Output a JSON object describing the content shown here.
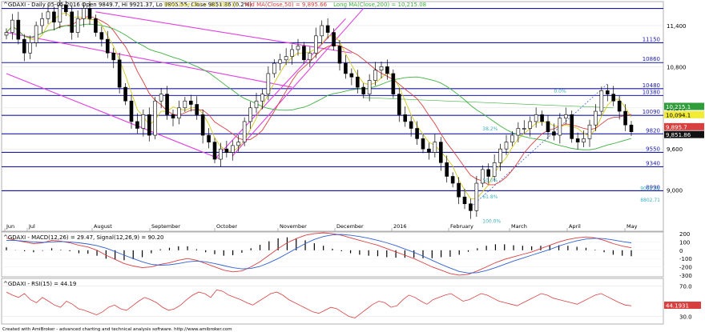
{
  "chart_data": [
    {
      "type": "candlestick",
      "title": "^GDAXI - Daily 05-05-2016 Open 9849.7, Hi 9921.37, Lo 9805.55, Close 9851.86 (0.2%)",
      "legend": [
        {
          "text": "MA(Close,20) = 10,094.12",
          "color": "#d4c81c"
        },
        {
          "text": "Mid MA(Close,50) = 9,895.66",
          "color": "#d84040"
        },
        {
          "text": "Long MA(Close,200) = 10,215.08",
          "color": "#40b040"
        }
      ],
      "y_ticks": [
        "11,400",
        "10,800",
        "10,200",
        "9,600",
        "9,000"
      ],
      "x_labels": [
        "Jun",
        "Jul",
        "August",
        "September",
        "October",
        "November",
        "December",
        "2016",
        "February",
        "March",
        "April",
        "May"
      ],
      "horizontal_levels": [
        {
          "value": 11650
        },
        {
          "value": 11150,
          "label": "11150"
        },
        {
          "value": 10860,
          "label": "10860"
        },
        {
          "value": 10480,
          "label": "10480"
        },
        {
          "value": 10380,
          "label": "10380"
        },
        {
          "value": 10090,
          "label": "10090"
        },
        {
          "value": 9820,
          "label": "9820"
        },
        {
          "value": 9550,
          "label": "9550"
        },
        {
          "value": 9340,
          "label": "9340"
        },
        {
          "value": 8990,
          "label": "8990"
        }
      ],
      "fib_labels": [
        "0.0%",
        "38.2%",
        "50.0%",
        "61.8%",
        "100.0%"
      ],
      "fib_price_labels": [
        "9000.55",
        "8802.71"
      ],
      "price_tags": [
        {
          "text": "10,215.1",
          "bg": "#2f9e3a",
          "fg": "#ffffff"
        },
        {
          "text": "10,094.1",
          "bg": "#f2ec36",
          "fg": "#000000"
        },
        {
          "text": "9,895.7",
          "bg": "#d84040",
          "fg": "#ffffff"
        },
        {
          "text": "9,851.86",
          "bg": "#111111",
          "fg": "#ffffff"
        }
      ],
      "ylim": [
        8400,
        11750
      ],
      "approx_closes": [
        11300,
        11480,
        11200,
        11000,
        11150,
        11400,
        11500,
        11600,
        11450,
        11700,
        11600,
        11300,
        11500,
        11650,
        11500,
        11300,
        11200,
        11000,
        10900,
        10500,
        10300,
        10000,
        9900,
        10100,
        9800,
        10300,
        10400,
        10100,
        10050,
        10200,
        10300,
        10250,
        10100,
        9800,
        9700,
        9450,
        9600,
        9550,
        9650,
        9700,
        10000,
        10200,
        10300,
        10400,
        10700,
        10850,
        10900,
        10950,
        11050,
        11100,
        10900,
        11000,
        11250,
        11400,
        11300,
        11100,
        10850,
        10700,
        10650,
        10500,
        10400,
        10600,
        10750,
        10800,
        10700,
        10400,
        10100,
        10000,
        9900,
        9750,
        9600,
        9550,
        9700,
        9400,
        9200,
        9100,
        8900,
        8800,
        8700,
        9100,
        9300,
        9200,
        9400,
        9600,
        9700,
        9800,
        9900,
        9900,
        10000,
        10100,
        10000,
        9850,
        9800,
        10050,
        10100,
        9750,
        9700,
        9750,
        9950,
        10150,
        10450,
        10400,
        10300,
        10150,
        9950,
        9851
      ]
    },
    {
      "type": "line",
      "title": "^GDAXI - MACD(12,26) = 29.47, Signal(12,26,9) = 90.20",
      "series": [
        {
          "name": "MACD(12,26)",
          "color": "#d84040"
        },
        {
          "name": "Signal(12,26,9)",
          "color": "#3060d0"
        }
      ],
      "y_ticks": [
        "200",
        "100",
        "0",
        "-100",
        "-200",
        "-300"
      ],
      "approx_macd": [
        150,
        120,
        100,
        80,
        90,
        120,
        110,
        90,
        60,
        40,
        0,
        -60,
        -110,
        -160,
        -190,
        -210,
        -200,
        -170,
        -150,
        -120,
        -100,
        -120,
        -160,
        -200,
        -240,
        -260,
        -250,
        -200,
        -140,
        -60,
        20,
        90,
        140,
        180,
        200,
        210,
        200,
        180,
        150,
        120,
        90,
        60,
        20,
        -20,
        -60,
        -100,
        -150,
        -200,
        -240,
        -280,
        -300,
        -290,
        -250,
        -200,
        -150,
        -110,
        -80,
        -50,
        -20,
        20,
        60,
        100,
        130,
        150,
        160,
        150,
        120,
        80,
        50,
        30
      ],
      "approx_signal": [
        120,
        118,
        110,
        100,
        95,
        100,
        105,
        100,
        90,
        75,
        55,
        25,
        -15,
        -60,
        -100,
        -140,
        -170,
        -180,
        -175,
        -160,
        -140,
        -130,
        -140,
        -160,
        -185,
        -210,
        -225,
        -220,
        -195,
        -150,
        -100,
        -40,
        20,
        80,
        130,
        165,
        185,
        190,
        180,
        165,
        145,
        120,
        90,
        55,
        15,
        -25,
        -70,
        -120,
        -170,
        -215,
        -255,
        -275,
        -270,
        -245,
        -210,
        -170,
        -130,
        -95,
        -60,
        -25,
        10,
        50,
        85,
        115,
        135,
        145,
        140,
        125,
        105,
        90
      ]
    },
    {
      "type": "line",
      "title": "^GDAXI - RSI(15) = 44.19",
      "series": [
        {
          "name": "RSI(15)",
          "color": "#d84040"
        }
      ],
      "y_ticks": [
        "70.0",
        "30.0"
      ],
      "price_tag": {
        "text": "44.1931",
        "bg": "#d84040",
        "fg": "#ffffff"
      },
      "approx_rsi": [
        62,
        58,
        55,
        60,
        52,
        48,
        55,
        50,
        45,
        42,
        50,
        46,
        40,
        38,
        35,
        32,
        36,
        42,
        45,
        40,
        38,
        44,
        50,
        55,
        52,
        48,
        42,
        38,
        40,
        45,
        52,
        58,
        62,
        60,
        55,
        65,
        63,
        58,
        55,
        52,
        48,
        45,
        50,
        55,
        60,
        62,
        58,
        52,
        48,
        44,
        40,
        36,
        34,
        38,
        42,
        40,
        35,
        30,
        28,
        34,
        40,
        46,
        50,
        48,
        42,
        44,
        52,
        58,
        55,
        50,
        46,
        52,
        55,
        58,
        60,
        55,
        50,
        52,
        56,
        60,
        58,
        54,
        50,
        48,
        46,
        44,
        48,
        52,
        56,
        60,
        58,
        54,
        52,
        50,
        48,
        46,
        50,
        54,
        58,
        60,
        56,
        52,
        48,
        45,
        44
      ]
    }
  ],
  "footer": {
    "text": "Created with AmiBroker - advanced charting and technical analysis software. http://www.amibroker.com"
  }
}
